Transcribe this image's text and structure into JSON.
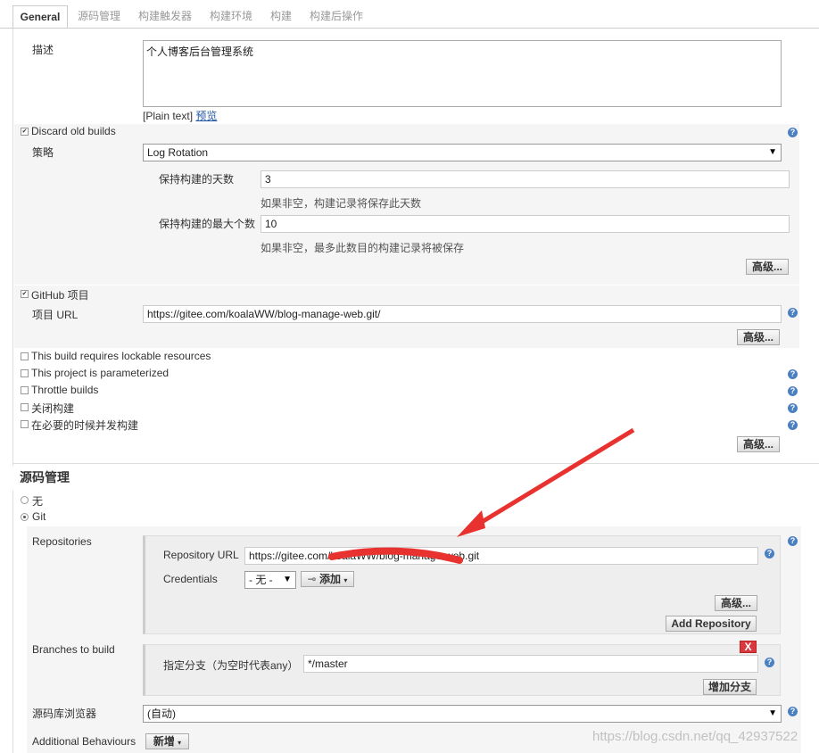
{
  "tabs": [
    "General",
    "源码管理",
    "构建触发器",
    "构建环境",
    "构建",
    "构建后操作"
  ],
  "general": {
    "description_label": "描述",
    "description_value": "个人博客后台管理系统",
    "plain_text": "[Plain text]",
    "preview": "预览",
    "discard_old_builds": "Discard old builds",
    "strategy_label": "策略",
    "strategy_value": "Log Rotation",
    "days_label": "保持构建的天数",
    "days_value": "3",
    "days_hint": "如果非空，构建记录将保存此天数",
    "max_label": "保持构建的最大个数",
    "max_value": "10",
    "max_hint": "如果非空，最多此数目的构建记录将被保存",
    "advanced": "高级...",
    "github_project": "GitHub 项目",
    "project_url_label": "项目 URL",
    "project_url_value": "https://gitee.com/koalaWW/blog-manage-web.git/",
    "lockable": "This build requires lockable resources",
    "parameterized": "This project is parameterized",
    "throttle": "Throttle builds",
    "disable_build": "关闭构建",
    "concurrent": "在必要的时候并发构建"
  },
  "scm": {
    "title": "源码管理",
    "none": "无",
    "git": "Git",
    "repositories_label": "Repositories",
    "repo_url_label": "Repository URL",
    "repo_url_value": "https://gitee.com/koalaWW/blog-manage-web.git",
    "credentials_label": "Credentials",
    "credentials_value": "- 无 -",
    "add_label": "添加",
    "advanced": "高级...",
    "add_repository": "Add Repository",
    "branches_label": "Branches to build",
    "branch_spec_label": "指定分支（为空时代表any）",
    "branch_spec_value": "*/master",
    "delete_branch": "X",
    "add_branch": "增加分支",
    "browser_label": "源码库浏览器",
    "browser_value": "(自动)",
    "additional_label": "Additional Behaviours",
    "additional_add": "新增"
  },
  "watermark": "https://blog.csdn.net/qq_42937522",
  "colors": {
    "arrow": "#e8322f",
    "help": "#4a7fc1",
    "delete": "#d9393e"
  }
}
